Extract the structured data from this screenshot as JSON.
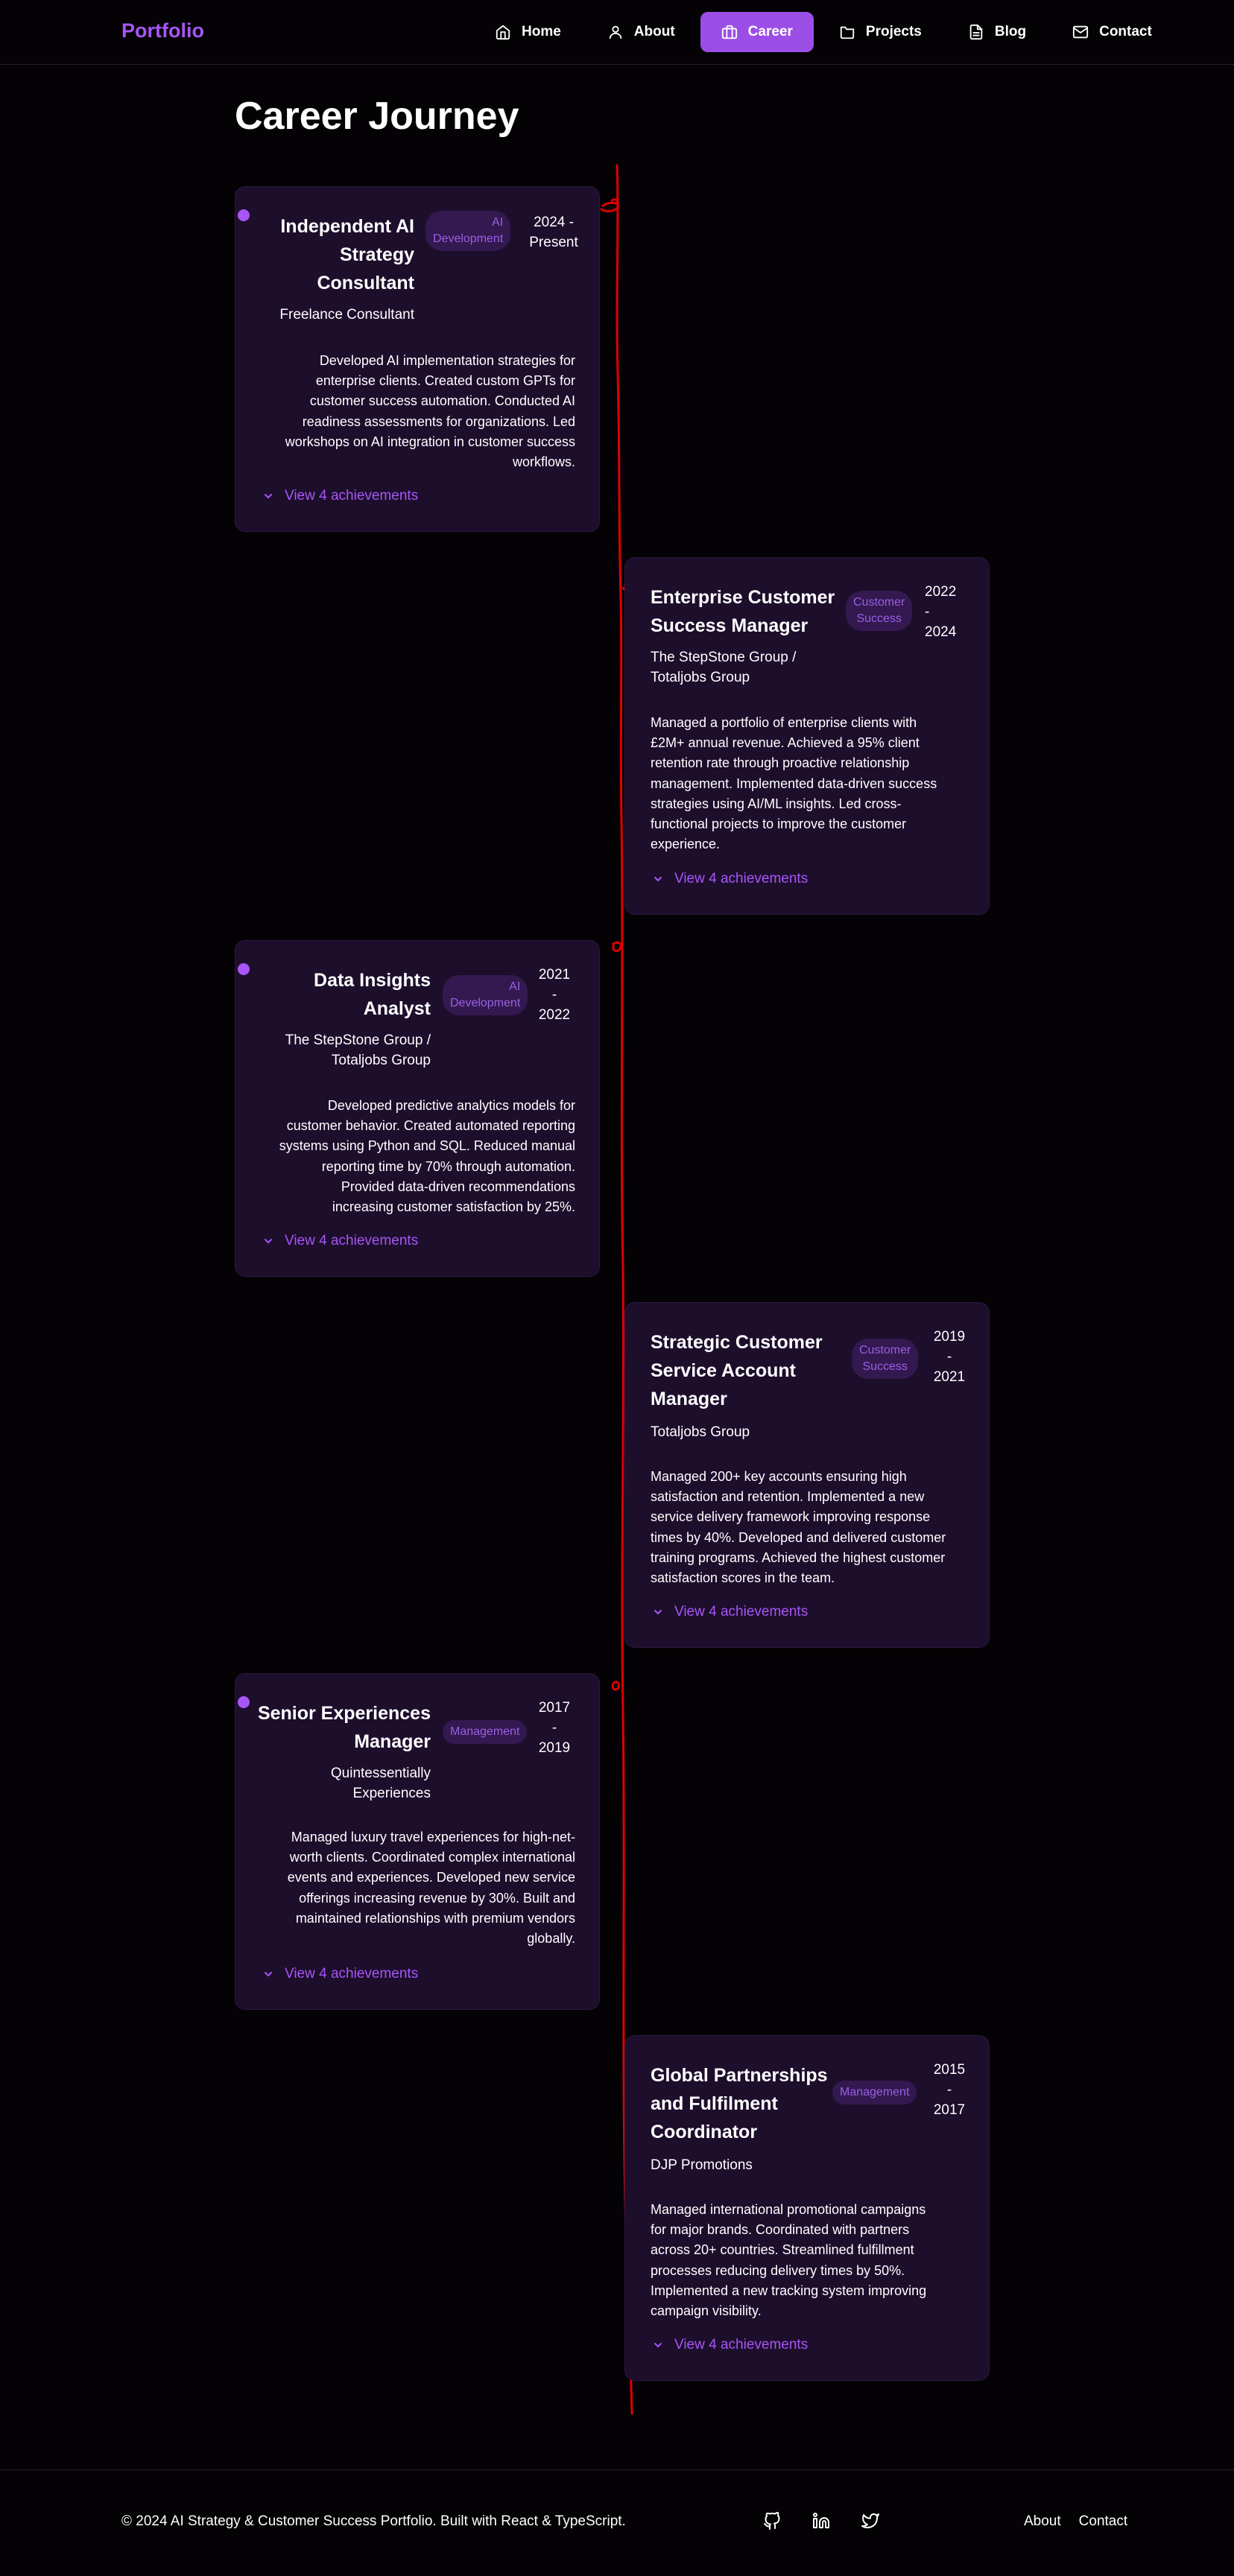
{
  "nav": {
    "logo": "Portfolio",
    "items": [
      {
        "label": "Home",
        "icon": "home-icon"
      },
      {
        "label": "About",
        "icon": "user-icon"
      },
      {
        "label": "Career",
        "icon": "briefcase-icon",
        "active": true
      },
      {
        "label": "Projects",
        "icon": "folder-icon"
      },
      {
        "label": "Blog",
        "icon": "document-icon"
      },
      {
        "label": "Contact",
        "icon": "mail-icon"
      }
    ]
  },
  "page": {
    "title": "Career Journey"
  },
  "colors": {
    "accent": "#a855f7",
    "active_nav": "#9b4ee6",
    "card_bg": "#1d0e2c",
    "badge_bg": "#33194f",
    "timeline": "#e00000",
    "background": "#050205"
  },
  "cards": [
    {
      "title_lines": [
        "Independent AI",
        "Strategy",
        "Consultant"
      ],
      "badge_lines": [
        "AI",
        "Development"
      ],
      "date_lines": [
        "2024 -",
        "Present"
      ],
      "company_lines": [
        "Freelance Consultant"
      ],
      "desc_lines": [
        "Developed AI implementation strategies for",
        "enterprise clients. Created custom GPTs for",
        "customer success automation. Conducted AI",
        "readiness assessments for organizations. Led",
        "workshops on AI integration in customer success",
        "workflows."
      ],
      "toggle": "View 4 achievements"
    },
    {
      "title_lines": [
        "Enterprise Customer",
        "Success Manager"
      ],
      "badge_lines": [
        "Customer",
        "Success"
      ],
      "date_lines": [
        "2022",
        "-",
        "2024"
      ],
      "company_lines": [
        "The StepStone Group /",
        "Totaljobs Group"
      ],
      "desc_lines": [
        "Managed a portfolio of enterprise clients with",
        "£2M+ annual revenue. Achieved a 95% client",
        "retention rate through proactive relationship",
        "management. Implemented data-driven success",
        "strategies using AI/ML insights. Led cross-",
        "functional projects to improve the customer",
        "experience."
      ],
      "toggle": "View 4 achievements"
    },
    {
      "title_lines": [
        "Data Insights",
        "Analyst"
      ],
      "badge_lines": [
        "AI",
        "Development"
      ],
      "date_lines": [
        "2021",
        "-",
        "2022"
      ],
      "company_lines": [
        "The StepStone Group /",
        "Totaljobs Group"
      ],
      "desc_lines": [
        "Developed predictive analytics models for",
        "customer behavior. Created automated reporting",
        "systems using Python and SQL. Reduced manual",
        "reporting time by 70% through automation.",
        "Provided data-driven recommendations",
        "increasing customer satisfaction by 25%."
      ],
      "toggle": "View 4 achievements"
    },
    {
      "title_lines": [
        "Strategic Customer",
        "Service Account",
        "Manager"
      ],
      "badge_lines": [
        "Customer",
        "Success"
      ],
      "date_lines": [
        "2019",
        "-",
        "2021"
      ],
      "company_lines": [
        "Totaljobs Group"
      ],
      "desc_lines": [
        "Managed 200+ key accounts ensuring high",
        "satisfaction and retention. Implemented a new",
        "service delivery framework improving response",
        "times by 40%. Developed and delivered customer",
        "training programs. Achieved the highest customer",
        "satisfaction scores in the team."
      ],
      "toggle": "View 4 achievements"
    },
    {
      "title_lines": [
        "Senior Experiences",
        "Manager"
      ],
      "badge_lines": [
        "Management"
      ],
      "date_lines": [
        "2017",
        "-",
        "2019"
      ],
      "company_lines": [
        "Quintessentially",
        "Experiences"
      ],
      "desc_lines": [
        "Managed luxury travel experiences for high-net-",
        "worth clients. Coordinated complex international",
        "events and experiences. Developed new service",
        "offerings increasing revenue by 30%. Built and",
        "maintained relationships with premium vendors",
        "globally."
      ],
      "toggle": "View 4 achievements"
    },
    {
      "title_lines": [
        "Global Partnerships",
        "and Fulfilment",
        "Coordinator"
      ],
      "badge_lines": [
        "Management"
      ],
      "date_lines": [
        "2015",
        "-",
        "2017"
      ],
      "company_lines": [
        "DJP Promotions"
      ],
      "desc_lines": [
        "Managed international promotional campaigns",
        "for major brands. Coordinated with partners",
        "across 20+ countries. Streamlined fulfillment",
        "processes reducing delivery times by 50%.",
        "Implemented a new tracking system improving",
        "campaign visibility."
      ],
      "toggle": "View 4 achievements"
    }
  ],
  "footer": {
    "copyright": "© 2024 AI Strategy & Customer Success Portfolio. Built with React & TypeScript.",
    "icons": [
      "github-icon",
      "linkedin-icon",
      "twitter-icon"
    ],
    "links": [
      "About",
      "Contact"
    ]
  }
}
